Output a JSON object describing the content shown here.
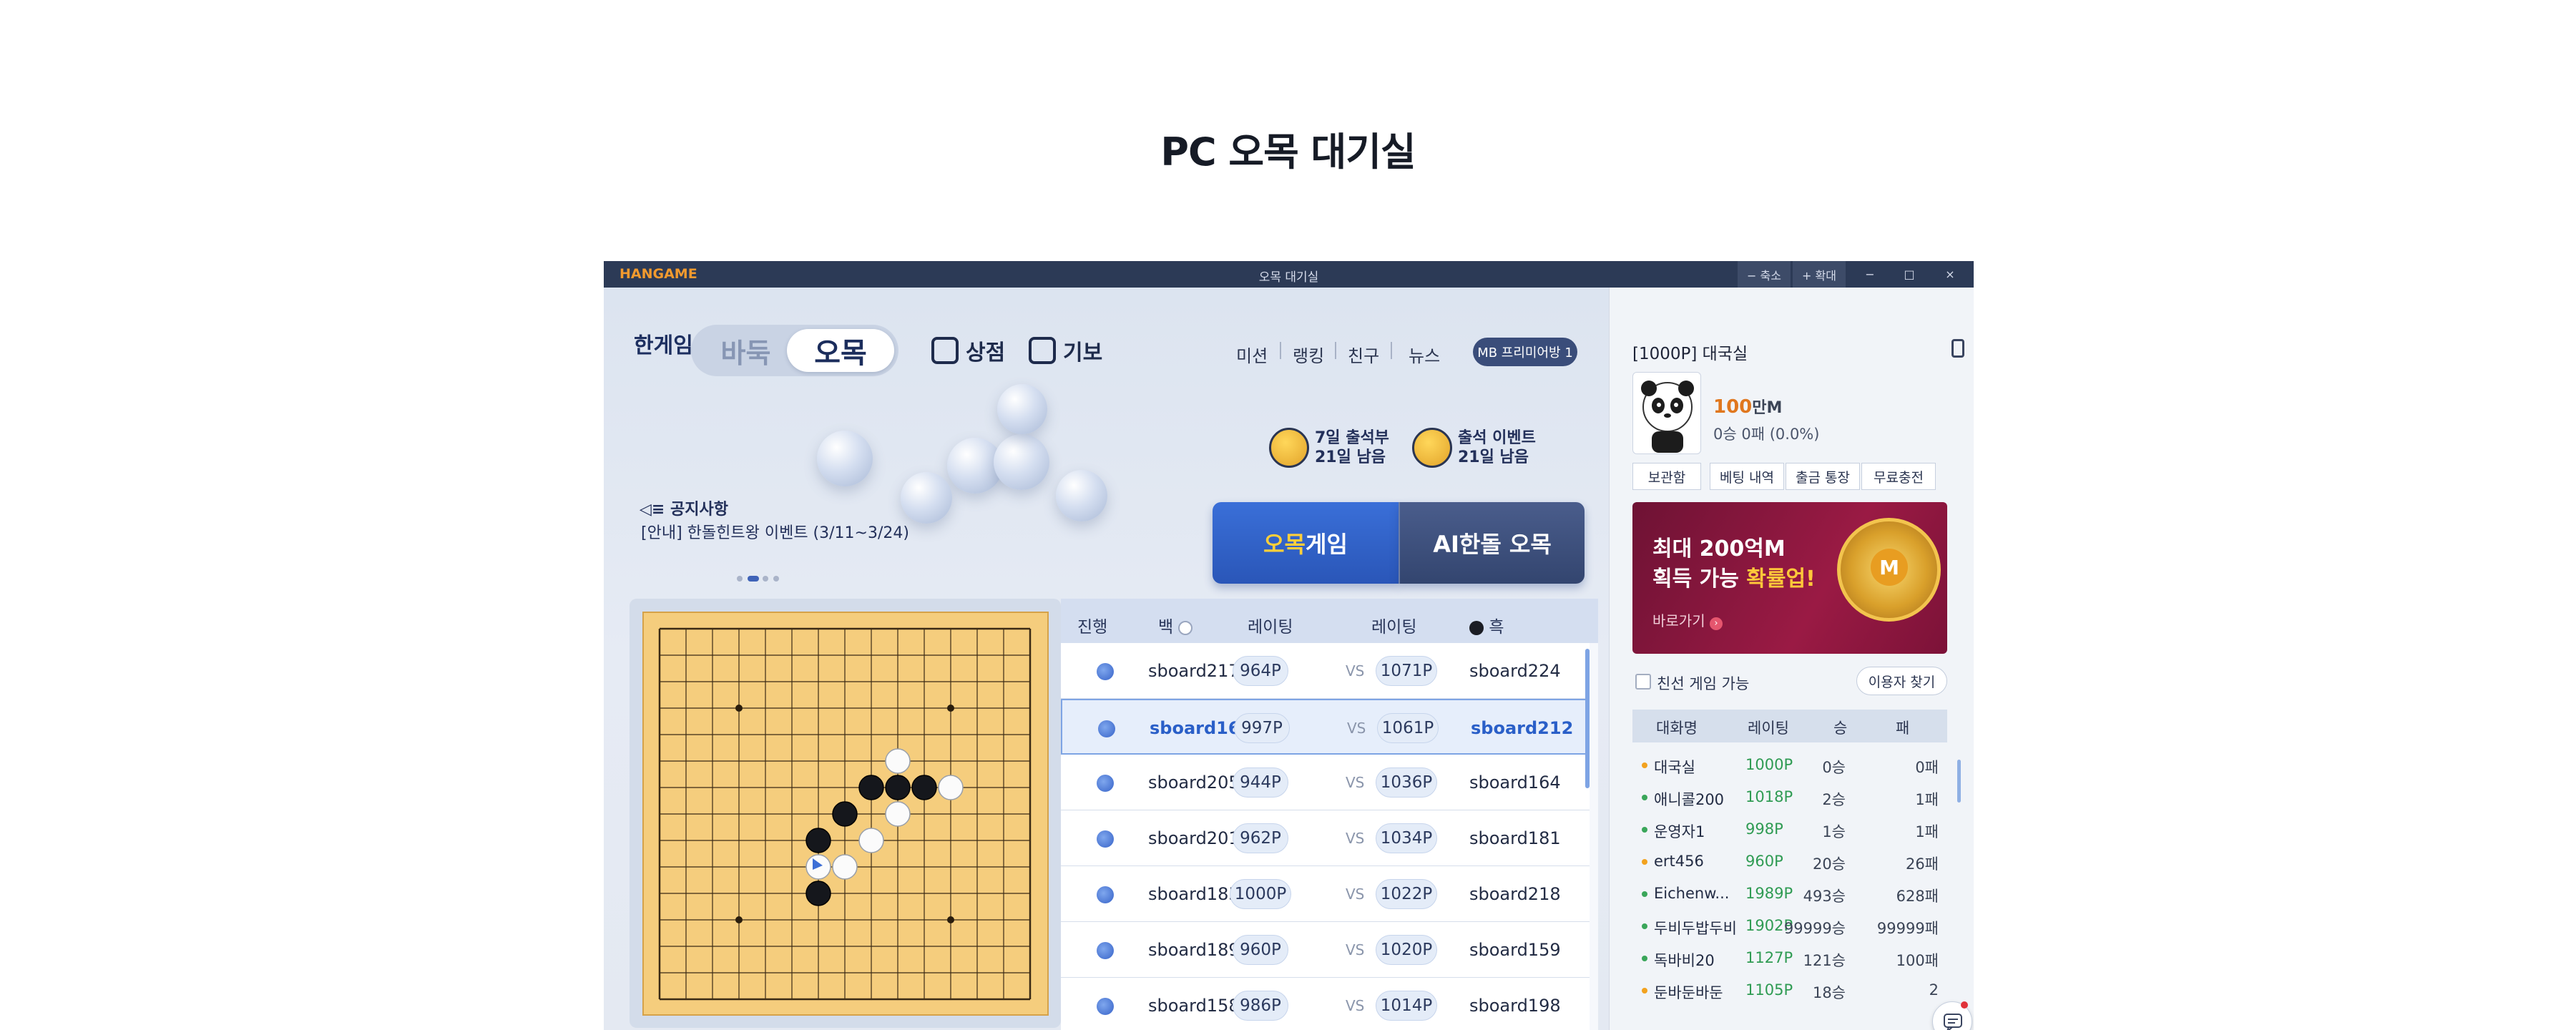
{
  "page_title": "PC 오목 대기실",
  "window": {
    "logo": "HANGAME",
    "title": "오목 대기실",
    "shrink": "− 축소",
    "expand": "+ 확대",
    "minimize": "−",
    "maximize": "□",
    "close": "×"
  },
  "header": {
    "hangame_logo": "한게임",
    "tab_baduk": "바둑",
    "tab_omok": "오목",
    "shop": "상점",
    "records": "기보",
    "menu": [
      "미션",
      "랭킹",
      "친구",
      "뉴스"
    ],
    "premium": "MB 프리미어방 1"
  },
  "events": [
    {
      "line1": "7일 출석부",
      "line2": "21일 남음"
    },
    {
      "line1": "출석 이벤트",
      "line2": "21일 남음"
    }
  ],
  "notice": {
    "label": "공지사항",
    "text": "[안내] 한돌힌트왕 이벤트 (3/11~3/24)"
  },
  "play_buttons": {
    "omok_game_highlight": "오목",
    "omok_game_rest": " 게임",
    "ai_omok": "AI한돌 오목"
  },
  "game_table": {
    "headers": [
      "진행",
      "백",
      "레이팅",
      "레이팅",
      "흑"
    ],
    "rows": [
      {
        "white": "sboard217",
        "white_rating": "964P",
        "vs": "VS",
        "black_rating": "1071P",
        "black": "sboard224",
        "selected": false
      },
      {
        "white": "sboard163",
        "white_rating": "997P",
        "vs": "VS",
        "black_rating": "1061P",
        "black": "sboard212",
        "selected": true
      },
      {
        "white": "sboard205",
        "white_rating": "944P",
        "vs": "VS",
        "black_rating": "1036P",
        "black": "sboard164",
        "selected": false
      },
      {
        "white": "sboard201",
        "white_rating": "962P",
        "vs": "VS",
        "black_rating": "1034P",
        "black": "sboard181",
        "selected": false
      },
      {
        "white": "sboard185",
        "white_rating": "1000P",
        "vs": "VS",
        "black_rating": "1022P",
        "black": "sboard218",
        "selected": false
      },
      {
        "white": "sboard189",
        "white_rating": "960P",
        "vs": "VS",
        "black_rating": "1020P",
        "black": "sboard159",
        "selected": false
      },
      {
        "white": "sboard158",
        "white_rating": "986P",
        "vs": "VS",
        "black_rating": "1014P",
        "black": "sboard198",
        "selected": false
      }
    ]
  },
  "board": {
    "size": 15,
    "star_points": [
      [
        3,
        3
      ],
      [
        3,
        11
      ],
      [
        11,
        3
      ],
      [
        11,
        11
      ]
    ],
    "black_stones": [
      [
        6,
        8
      ],
      [
        6,
        10
      ],
      [
        7,
        7
      ],
      [
        8,
        6
      ],
      [
        9,
        6
      ],
      [
        10,
        6
      ]
    ],
    "white_stones": [
      [
        6,
        9
      ],
      [
        7,
        9
      ],
      [
        8,
        8
      ],
      [
        9,
        5
      ],
      [
        9,
        7
      ],
      [
        11,
        6
      ]
    ],
    "last_move": [
      6,
      9
    ]
  },
  "side": {
    "room_title": "[1000P] 대국실",
    "money_value": "100",
    "money_unit": "만M",
    "record": "0승 0패 (0.0%)",
    "storage": "보관함",
    "buttons": [
      "베팅 내역",
      "출금 통장",
      "무료충전"
    ],
    "banner_line1": "최대 200억M",
    "banner_line2_a": "획득 가능 ",
    "banner_line2_b": "확률업!",
    "banner_go": "바로가기",
    "coin_letter": "M",
    "friend_label": "친선 게임 가능",
    "find_user": "이용자 찾기",
    "user_headers": [
      "대화명",
      "레이팅",
      "승",
      "패"
    ],
    "users": [
      {
        "name": "대국실",
        "rating": "1000P",
        "wins": "0승",
        "losses": "0패",
        "dot": "#f2a21f"
      },
      {
        "name": "애니콜200",
        "rating": "1018P",
        "wins": "2승",
        "losses": "1패",
        "dot": "#3aa65a"
      },
      {
        "name": "운영자1",
        "rating": "998P",
        "wins": "1승",
        "losses": "1패",
        "dot": "#3aa65a"
      },
      {
        "name": "ert456",
        "rating": "960P",
        "wins": "20승",
        "losses": "26패",
        "dot": "#f2a21f"
      },
      {
        "name": "Eichenw...",
        "rating": "1989P",
        "wins": "493승",
        "losses": "628패",
        "dot": "#3aa65a"
      },
      {
        "name": "두비두밥두비",
        "rating": "1902P",
        "wins": "99999승",
        "losses": "99999패",
        "dot": "#3aa65a"
      },
      {
        "name": "독바비20",
        "rating": "1127P",
        "wins": "121승",
        "losses": "100패",
        "dot": "#3aa65a"
      },
      {
        "name": "둔바둔바둔",
        "rating": "1105P",
        "wins": "18승",
        "losses": "2",
        "dot": "#f2a21f"
      }
    ]
  },
  "colors": {
    "titlebar": "#2c3a56",
    "accent_blue": "#2a56b8",
    "rating_green": "#2f9b53",
    "money_orange": "#e0771e",
    "board_wood": "#f5cd7d"
  }
}
